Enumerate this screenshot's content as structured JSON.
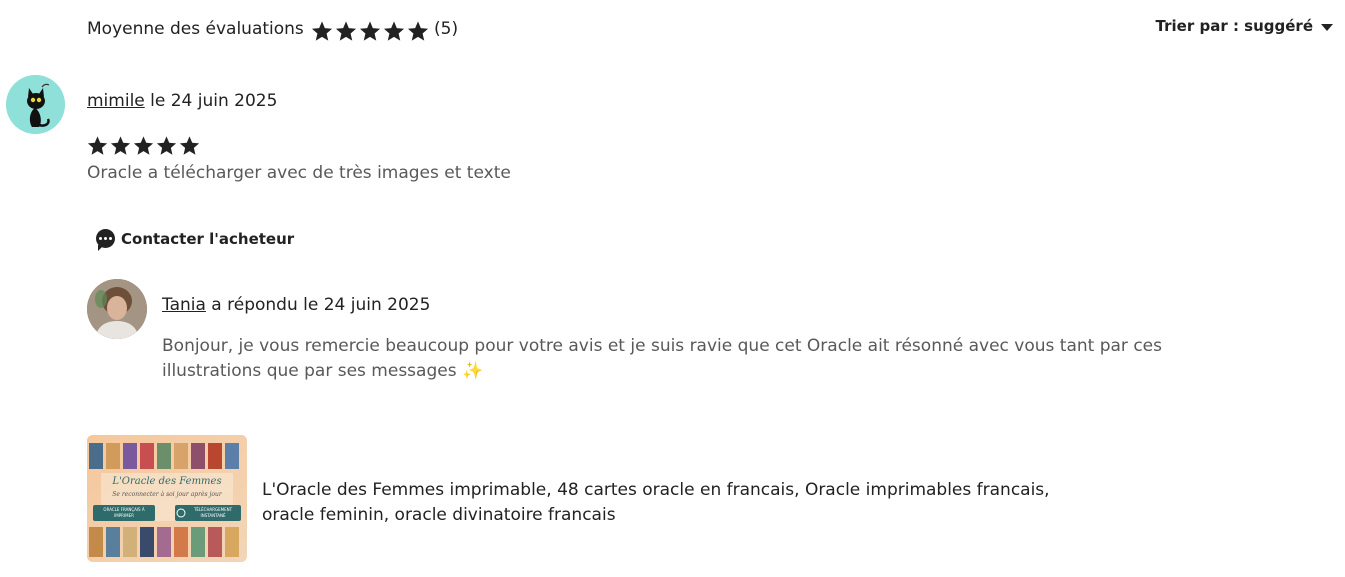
{
  "summary": {
    "label": "Moyenne des évaluations",
    "rating": 5,
    "count": "(5)"
  },
  "sort": {
    "label": "Trier par : suggéré"
  },
  "review": {
    "author": "mimile",
    "date": " le 24 juin 2025",
    "rating": 5,
    "text": "Oracle a télécharger avec de très images et texte",
    "contact_label": "Contacter l'acheteur"
  },
  "reply": {
    "author": "Tania",
    "date": " a répondu le 24 juin 2025",
    "text": "Bonjour, je vous remercie beaucoup pour votre avis et je suis ravie que cet Oracle ait résonné avec vous tant par ces illustrations que par ses messages ✨"
  },
  "product": {
    "title": "L'Oracle des Femmes imprimable, 48 cartes oracle en francais, Oracle imprimables francais, oracle feminin, oracle divinatoire francais",
    "thumb_title": "L'Oracle des Femmes",
    "thumb_subtitle": "Se reconnecter à soi jour après jour",
    "badge_left": "ORACLE FRANÇAIS À IMPRIMER",
    "badge_right": "TÉLÉCHARGEMENT INSTANTANÉ"
  },
  "colors": {
    "star": "#222222",
    "text_secondary": "#595959",
    "avatar_bg": "#8fe0d8"
  }
}
